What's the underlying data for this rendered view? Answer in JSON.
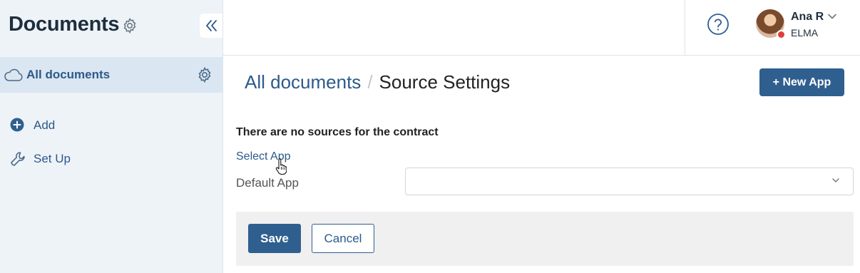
{
  "sidebar": {
    "title": "Documents",
    "active_item": {
      "label": "All documents",
      "icon": "cloud-icon"
    },
    "actions": [
      {
        "label": "Add",
        "icon": "add-circle-icon"
      },
      {
        "label": "Set Up",
        "icon": "wrench-icon"
      }
    ]
  },
  "header": {
    "help_icon": "help-circle-icon",
    "user": {
      "name": "Ana R",
      "company": "ELMA",
      "status_color": "#e03c3c"
    }
  },
  "main": {
    "breadcrumb": {
      "parent": "All documents",
      "separator": "/",
      "current": "Source Settings"
    },
    "new_app_label": "+ New App",
    "empty_message": "There are no sources for the contract",
    "select_app_link": "Select App",
    "default_app": {
      "label": "Default App",
      "value": ""
    },
    "save_label": "Save",
    "cancel_label": "Cancel"
  },
  "colors": {
    "accent": "#2f5f8f",
    "link": "#2c5a8a",
    "sidebar_bg": "#eef3f8",
    "sidebar_active_bg": "#dae6f1"
  }
}
